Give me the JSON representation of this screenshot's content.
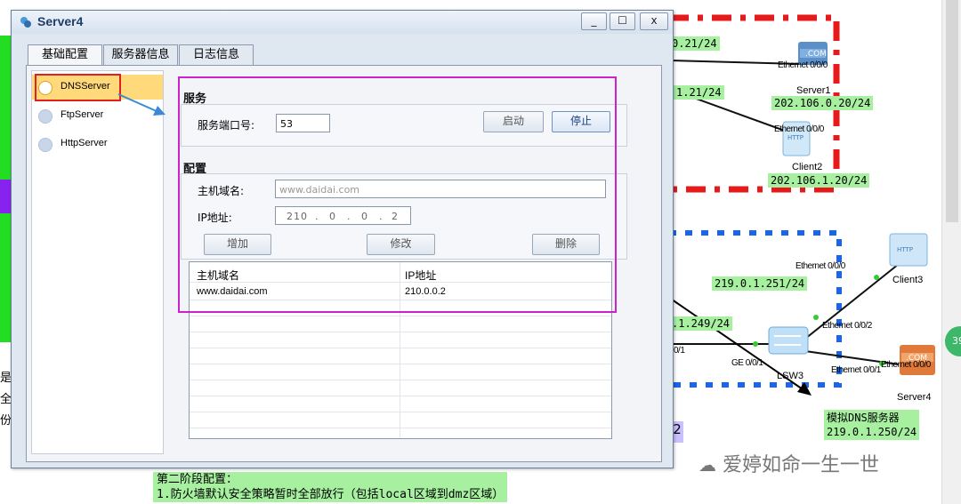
{
  "window": {
    "title": "Server4",
    "buttons": {
      "minimize": "_",
      "maximize": "☐",
      "close": "x"
    }
  },
  "tabs": [
    {
      "label": "基础配置",
      "active": true
    },
    {
      "label": "服务器信息",
      "active": false
    },
    {
      "label": "日志信息",
      "active": false
    }
  ],
  "server_list": [
    {
      "label": "DNSServer",
      "selected": true
    },
    {
      "label": "FtpServer",
      "selected": false
    },
    {
      "label": "HttpServer",
      "selected": false
    }
  ],
  "service": {
    "title": "服务",
    "port_label": "服务端口号:",
    "port_value": "53",
    "start_button": "启动",
    "stop_button": "停止"
  },
  "config": {
    "title": "配置",
    "domain_label": "主机域名:",
    "domain_placeholder": "www.daidai.com",
    "ip_label": "IP地址:",
    "ip_octets": [
      "210",
      "0",
      "0",
      "2"
    ],
    "add_button": "增加",
    "modify_button": "修改",
    "delete_button": "删除"
  },
  "dns_table": {
    "headers": [
      "主机域名",
      "IP地址"
    ],
    "rows": [
      [
        "www.daidai.com",
        "210.0.0.2"
      ]
    ]
  },
  "topology": {
    "labels": {
      "l1": "0.21/24",
      "l2": "1.21/24",
      "server1_ip": "202.106.0.20/24",
      "client2_ip": "202.106.1.20/24",
      "l3": "219.0.1.251/24",
      "l4": ".1.249/24",
      "server4_ip_note": "模拟DNS服务器\n219.0.1.250/24",
      "left_num": "2"
    },
    "devices": {
      "server1": "Server1",
      "server1_port": "Ethernet 0/0/0",
      "client2": "Client2",
      "client2_port": "Ethernet 0/0/0",
      "client3": "Client3",
      "client3_port": "Ethernet 0/0/0",
      "lsw3": "LSW3",
      "lsw3_port1": "Ethernet 0/0/2",
      "lsw3_port2": "Ethernet 0/0/1",
      "lsw3_ge": "GE 0/0/1",
      "server4": "Server4",
      "server4_port": "Ethernet 0/0/0",
      "left_port": "0/1"
    },
    "colors": {
      "dmz": "#e61a1a",
      "inside": "#1a66e6"
    }
  },
  "bottom_note": "第二阶段配置：\n1.防火墙默认安全策略暂时全部放行（包括local区域到dmz区域）",
  "watermark": "爱婷如命一生一世",
  "left_edge_text": [
    "是",
    "全",
    "份"
  ],
  "badge": "39"
}
